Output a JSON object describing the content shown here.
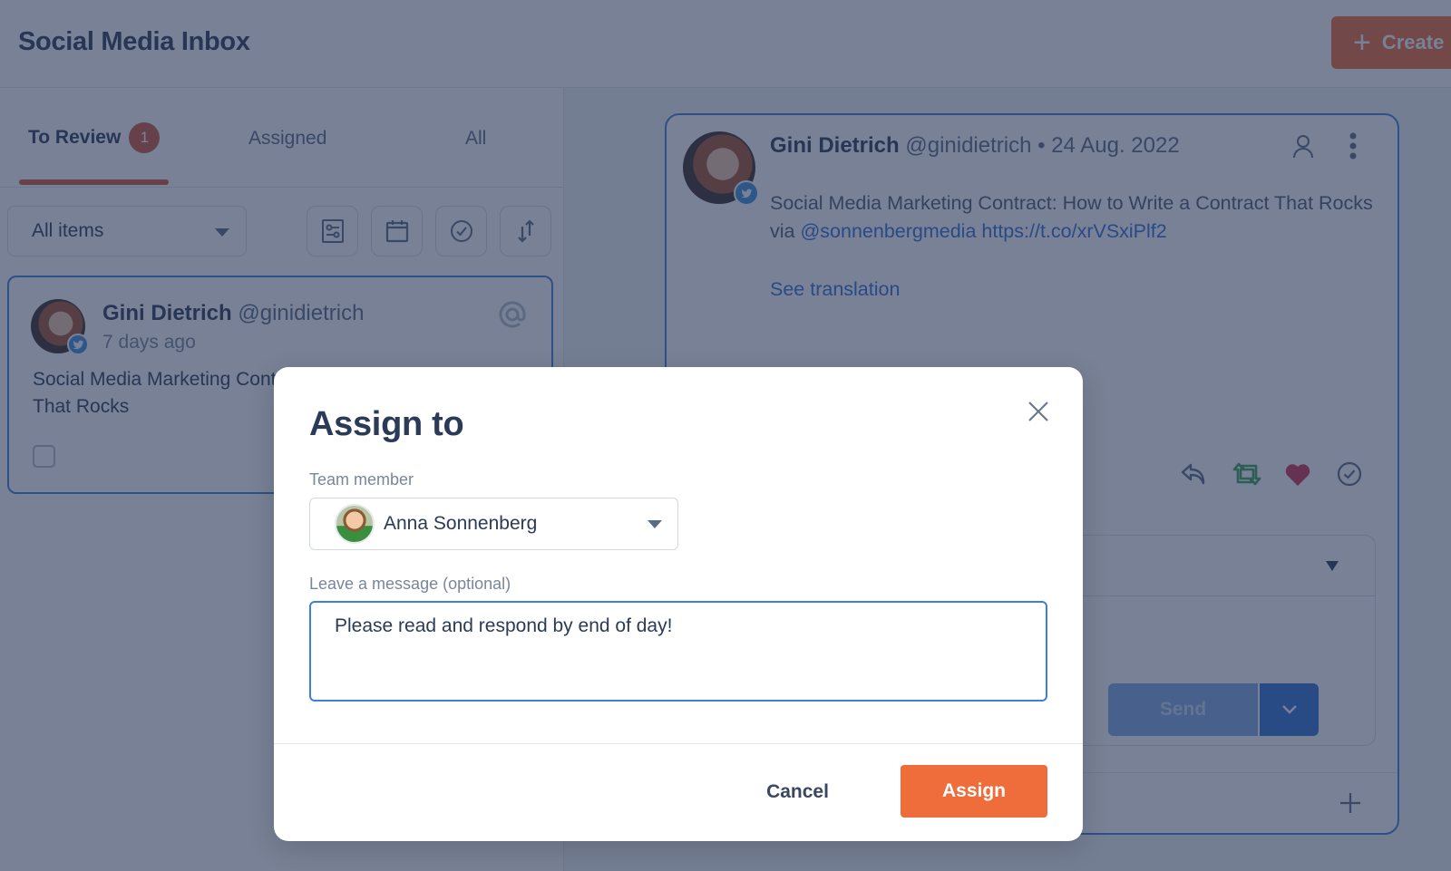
{
  "header": {
    "title": "Social Media Inbox",
    "create_label": "Create"
  },
  "tabs": [
    {
      "label": "To Review",
      "badge": "1",
      "active": true
    },
    {
      "label": "Assigned"
    },
    {
      "label": "All"
    }
  ],
  "filters": {
    "selected": "All items",
    "tools": [
      "filter-settings-icon",
      "calendar-icon",
      "check-circle-icon",
      "sort-icon"
    ]
  },
  "inbox_item": {
    "name": "Gini Dietrich",
    "handle": "@ginidietrich",
    "time": "7 days ago",
    "text": "Social Media Marketing Contract: How to Write a Contract That Rocks",
    "network": "twitter"
  },
  "detail": {
    "name": "Gini Dietrich",
    "handle": "@ginidietrich",
    "separator": "•",
    "date": "24 Aug. 2022",
    "text": "Social Media Marketing Contract: How to Write a Contract That Rocks via ",
    "mention": "@sonnenbergmedia",
    "link": "https://t.co/xrVSxiPlf2",
    "see_translation": "See translation",
    "send_label": "Send",
    "colors": {
      "retweet": "#3aa35a",
      "like": "#d0314f",
      "accent": "#2f6fd6"
    }
  },
  "modal": {
    "title": "Assign to",
    "team_member_label": "Team member",
    "team_member_value": "Anna Sonnenberg",
    "message_label": "Leave a message (optional)",
    "message_value": "Please read and respond by end of day!",
    "cancel_label": "Cancel",
    "assign_label": "Assign",
    "assign_color": "#ee6d3a"
  }
}
